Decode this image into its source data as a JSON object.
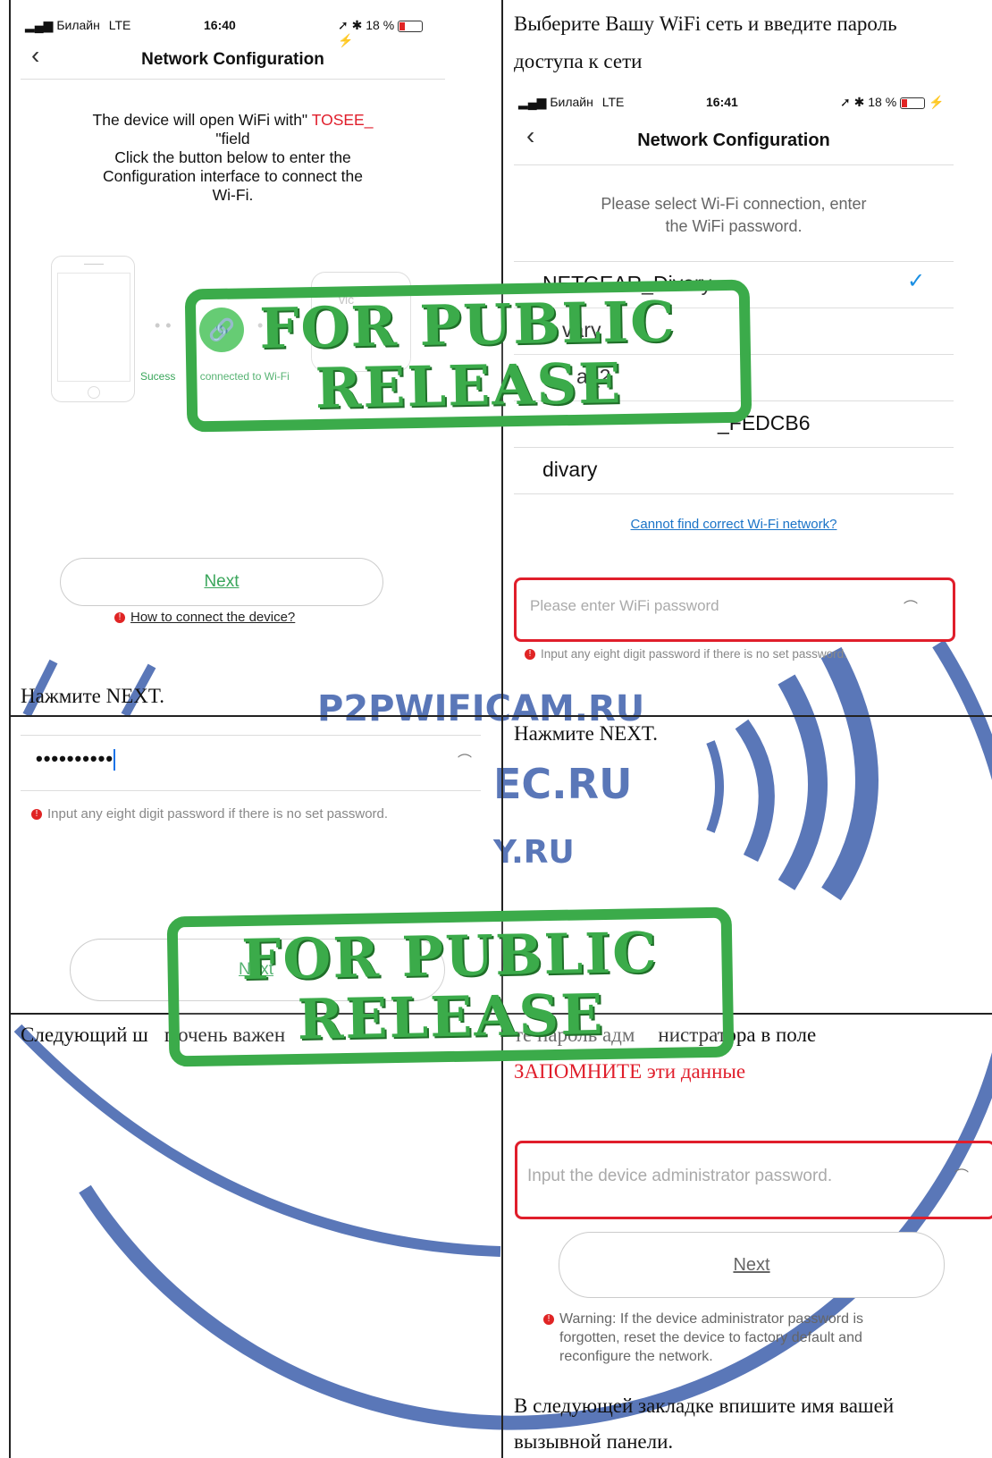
{
  "cell_tl": {
    "status": {
      "carrier": "Билайн",
      "net": "LTE",
      "time": "16:40",
      "battery": "18 %"
    },
    "nav_title": "Network Configuration",
    "message_prefix": "The device will open WiFi with\"",
    "message_highlight": "TOSEE_",
    "message_line2": "\"field",
    "message_line3": "Click the button below to enter the",
    "message_line4": "Configuration interface to connect the",
    "message_line5": "Wi-Fi.",
    "success_text": "Sucess",
    "success_text2": "connected to Wi-Fi",
    "device_label": "vic",
    "next_label": "Next",
    "help_link": "How to connect the device?"
  },
  "caption_tl": "Нажмите NEXT.",
  "cell_tr": {
    "instruction_line1": "Выберите Вашу WiFi сеть и введите пароль",
    "instruction_line2": "доступа к сети",
    "status": {
      "carrier": "Билайн",
      "net": "LTE",
      "time": "16:41",
      "battery": "18 %"
    },
    "nav_title": "Network Configuration",
    "prompt_line1": "Please select Wi-Fi connection, enter",
    "prompt_line2": "the WiFi password.",
    "networks": [
      "NETGEAR_Divary",
      "vary",
      "a_2",
      "_FEDCB6",
      "divary"
    ],
    "cannot_find": "Cannot find correct Wi-Fi network?",
    "password_placeholder": "Please enter WiFi password",
    "hint": "Input any eight digit password if there is no set password."
  },
  "cell_ml": {
    "password_value": "••••••••••",
    "hint": "Input any eight digit password if there is no set password.",
    "next_label": "Next"
  },
  "caption_mr": "Нажмите NEXT.",
  "caption_bl": "Следующий ш",
  "caption_bl2": "г очень важен",
  "cell_br": {
    "instruction_part1": "нистратора в поле",
    "instruction_hidden": "те пароль адм",
    "remember": "ЗАПОМНИТЕ эти данные",
    "admin_placeholder": "Input the device administrator password.",
    "next_label": "Next",
    "warning_line1": "Warning: If the device administrator password is",
    "warning_line2": "forgotten, reset the device to factory default and",
    "warning_line3": "reconfigure the network.",
    "footer_line1": "В следующей закладке впишите имя вашей",
    "footer_line2": "вызывной панели."
  },
  "stamp": {
    "line1": "FOR PUBLIC",
    "line2": "RELEASE"
  },
  "watermark": {
    "line1": "P2PWIFICAM.RU",
    "line2": "EC.RU",
    "line3": "Y.RU"
  },
  "colors": {
    "accent_green": "#3aa65b",
    "alert_red": "#e01e2b",
    "link_blue": "#1a73c7",
    "stamp_green": "#3bab4a",
    "watermark_blue": "#5a77b8"
  }
}
